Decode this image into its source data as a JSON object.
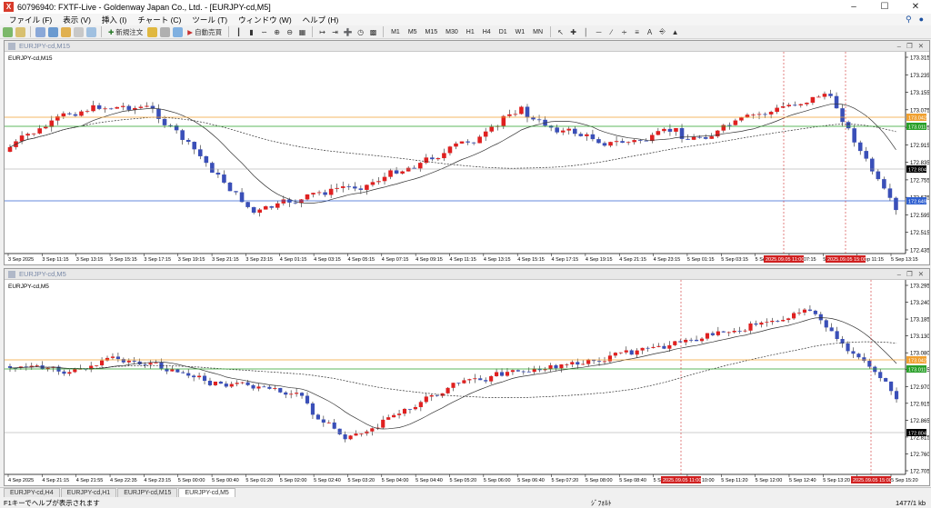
{
  "app": {
    "title": "60796940: FXTF-Live - Goldenway Japan Co., Ltd. - [EURJPY-cd,M5]",
    "logo": "X"
  },
  "menu": [
    "ファイル (F)",
    "表示 (V)",
    "挿入 (I)",
    "チャート (C)",
    "ツール (T)",
    "ウィンドウ (W)",
    "ヘルプ (H)"
  ],
  "toolbar": {
    "new_order": "新規注文",
    "auto_trade": "自動売買",
    "timeframes": [
      "M1",
      "M5",
      "M15",
      "M30",
      "H1",
      "H4",
      "D1",
      "W1",
      "MN"
    ]
  },
  "colors": {
    "bull": "#e02020",
    "bear": "#3a4fb8",
    "orange": "#f0a030",
    "green": "#2aa02a",
    "blue": "#3060d0"
  },
  "top_chart": {
    "window_title": "EURJPY-cd,M15",
    "label": "EURJPY-cd,M15",
    "price_labels": [
      "173.315",
      "173.235",
      "173.155",
      "173.075",
      "172.995",
      "172.915",
      "172.835",
      "172.755",
      "172.675",
      "172.595",
      "172.515",
      "172.435"
    ],
    "time_labels": [
      "3 Sep 2025",
      "3 Sep 11:15",
      "3 Sep 13:15",
      "3 Sep 15:15",
      "3 Sep 17:15",
      "3 Sep 19:15",
      "3 Sep 21:15",
      "3 Sep 23:15",
      "4 Sep 01:15",
      "4 Sep 03:15",
      "4 Sep 05:15",
      "4 Sep 07:15",
      "4 Sep 09:15",
      "4 Sep 11:15",
      "4 Sep 13:15",
      "4 Sep 15:15",
      "4 Sep 17:15",
      "4 Sep 19:15",
      "4 Sep 21:15",
      "4 Sep 23:15",
      "5 Sep 01:15",
      "5 Sep 03:15",
      "5 Sep 05:15",
      "5 Sep 07:15",
      "5 Sep 09:15",
      "5 Sep 11:15",
      "5 Sep 13:15"
    ],
    "marker_times": [
      "2025.09.05 11:00",
      "2025.09.05 15:00"
    ],
    "level_labels": {
      "orange": "173.042",
      "green": "173.011",
      "current": "172.804",
      "blue": "172.649"
    }
  },
  "bottom_chart": {
    "window_title": "EURJPY-cd,M5",
    "label": "EURJPY-cd,M5",
    "price_labels": [
      "173.295",
      "173.240",
      "173.185",
      "173.130",
      "173.080",
      "173.025",
      "172.970",
      "172.915",
      "172.865",
      "172.815",
      "172.760",
      "172.705"
    ],
    "time_labels": [
      "4 Sep 2025",
      "4 Sep 21:15",
      "4 Sep 21:55",
      "4 Sep 22:35",
      "4 Sep 23:15",
      "5 Sep 00:00",
      "5 Sep 00:40",
      "5 Sep 01:20",
      "5 Sep 02:00",
      "5 Sep 02:40",
      "5 Sep 03:20",
      "5 Sep 04:00",
      "5 Sep 04:40",
      "5 Sep 05:20",
      "5 Sep 06:00",
      "5 Sep 06:40",
      "5 Sep 07:20",
      "5 Sep 08:00",
      "5 Sep 08:40",
      "5 Sep 09:20",
      "5 Sep 10:00",
      "5 Sep 11:20",
      "5 Sep 12:00",
      "5 Sep 12:40",
      "5 Sep 13:20",
      "5 Sep 14:00",
      "5 Sep 15:20"
    ],
    "marker_times": [
      "2025.09.05 11:00",
      "2025.09.05 15:00"
    ],
    "level_labels": {
      "orange": "173.042",
      "green": "173.011",
      "current": "172.804"
    }
  },
  "tabs": [
    "EURJPY-cd,H4",
    "EURJPY-cd,H1",
    "EURJPY-cd,M15",
    "EURJPY-cd,M5"
  ],
  "active_tab": 3,
  "status": {
    "help": "F1キーでヘルプが表示されます",
    "profile": "ｼﾞﾌｫﾙﾄ",
    "traffic": "1477/1 kb"
  }
}
